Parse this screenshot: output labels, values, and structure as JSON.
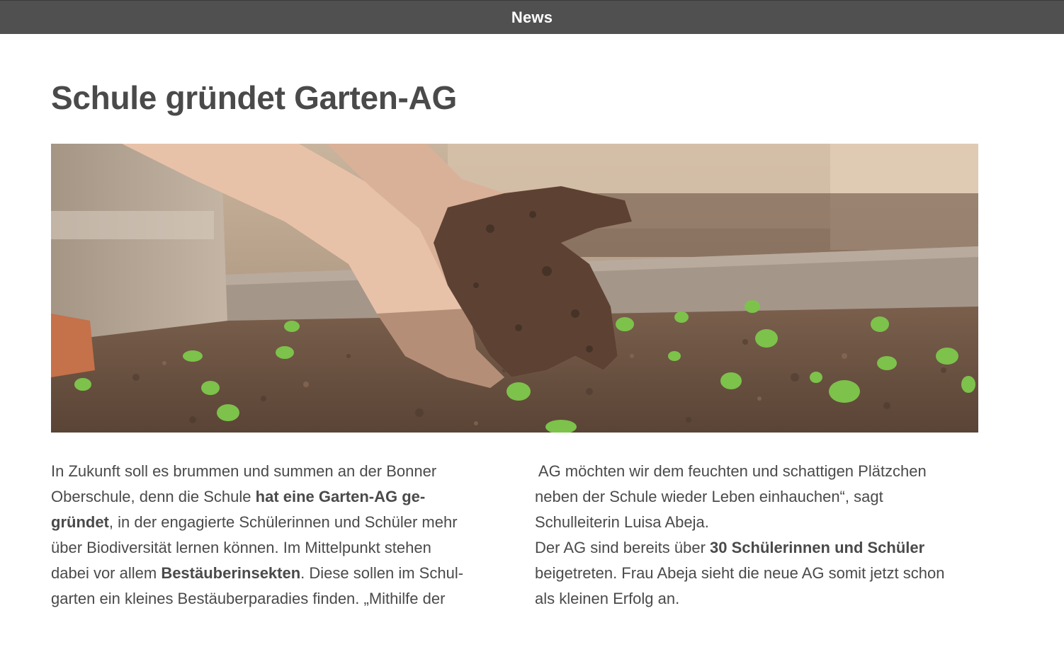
{
  "header": {
    "label": "News"
  },
  "article": {
    "title": "Schule gründet Garten-AG",
    "image": {
      "icon": "garden-photo-icon",
      "description_colors": {
        "soil": "#6b5444",
        "wood": "#b9a894",
        "seedling": "#7dc24b",
        "skin": "#e8c2a8"
      }
    },
    "left_column": {
      "l1": "In Zukunft soll es brummen und summen an der Bonner",
      "l2a": "Oberschule, denn die Schule ",
      "l2b": "hat eine Garten-AG ge-",
      "l3a": "gründet",
      "l3b": ", in der engagierte Schülerinnen und Schüler mehr",
      "l4": "über Biodiversität lernen können. Im Mittelpunkt stehen",
      "l5a": "dabei vor allem ",
      "l5b": "Bestäuberinsekten",
      "l5c": ". Diese sollen im Schul-",
      "l6": "garten ein kleines Bestäuberparadies finden. „Mithilfe der"
    },
    "right_column": {
      "l1": " AG möchten wir dem feuchten und schattigen Plätzchen",
      "l2": "neben der Schule wieder Leben einhauchen“, sagt",
      "l3": "Schulleiterin Luisa Abeja.",
      "l4a": "Der AG sind bereits über ",
      "l4b": "30 Schülerinnen und Schüler",
      "l5": "beigetreten. Frau Abeja sieht die neue AG somit jetzt schon",
      "l6": "als kleinen Erfolg an."
    }
  }
}
